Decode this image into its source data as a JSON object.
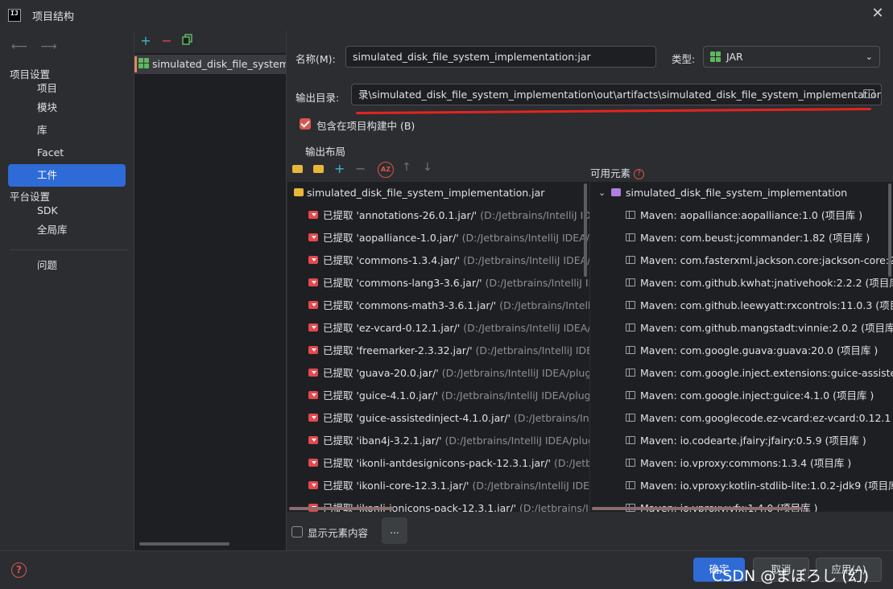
{
  "window": {
    "title": "项目结构",
    "logo_text": "IJ"
  },
  "nav": {
    "back_glyph": "⟵",
    "forward_glyph": "⟶"
  },
  "sidebar": {
    "group1": "项目设置",
    "group2": "平台设置",
    "items": [
      {
        "label": "项目"
      },
      {
        "label": "模块"
      },
      {
        "label": "库"
      },
      {
        "label": "Facet"
      },
      {
        "label": "工件"
      },
      {
        "label": "SDK"
      },
      {
        "label": "全局库"
      },
      {
        "label": "问题"
      }
    ]
  },
  "artifacts_panel": {
    "add_glyph": "+",
    "remove_glyph": "−",
    "items": [
      {
        "label": "simulated_disk_file_system_"
      }
    ]
  },
  "form": {
    "name_label": "名称(M):",
    "name_value": "simulated_disk_file_system_implementation:jar",
    "type_label": "类型:",
    "type_value": "JAR",
    "output_dir_label": "输出目录:",
    "output_dir_value": "录\\simulated_disk_file_system_implementation\\out\\artifacts\\simulated_disk_file_system_implementation_jar",
    "include_in_build_label": "包含在项目构建中 (B)",
    "include_in_build": true
  },
  "layout_section": {
    "title": "输出布局",
    "available_title": "可用元素",
    "root_jar": "simulated_disk_file_system_implementation.jar",
    "extracted_items": [
      {
        "name": "已提取 'annotations-26.0.1.jar/'",
        "path": "(D:/Jetbrains/IntelliJ IDEA/"
      },
      {
        "name": "已提取 'aopalliance-1.0.jar/'",
        "path": "(D:/Jetbrains/IntelliJ IDEA/plug"
      },
      {
        "name": "已提取 'commons-1.3.4.jar/'",
        "path": "(D:/Jetbrains/IntelliJ IDEA/plu"
      },
      {
        "name": "已提取 'commons-lang3-3.6.jar/'",
        "path": "(D:/Jetbrains/IntelliJ IDEA"
      },
      {
        "name": "已提取 'commons-math3-3.6.1.jar/'",
        "path": "(D:/Jetbrains/IntelliJ ID"
      },
      {
        "name": "已提取 'ez-vcard-0.12.1.jar/'",
        "path": "(D:/Jetbrains/IntelliJ IDEA/plug"
      },
      {
        "name": "已提取 'freemarker-2.3.32.jar/'",
        "path": "(D:/Jetbrains/IntelliJ IDEA/p"
      },
      {
        "name": "已提取 'guava-20.0.jar/'",
        "path": "(D:/Jetbrains/IntelliJ IDEA/plugins/"
      },
      {
        "name": "已提取 'guice-4.1.0.jar/'",
        "path": "(D:/Jetbrains/IntelliJ IDEA/plugins/"
      },
      {
        "name": "已提取 'guice-assistedinject-4.1.0.jar/'",
        "path": "(D:/Jetbrains/IntelliJ"
      },
      {
        "name": "已提取 'iban4j-3.2.1.jar/'",
        "path": "(D:/Jetbrains/IntelliJ IDEA/plugins"
      },
      {
        "name": "已提取 'ikonli-antdesignicons-pack-12.3.1.jar/'",
        "path": "(D:/Jetbrain"
      },
      {
        "name": "已提取 'ikonli-core-12.3.1.jar/'",
        "path": "(D:/Jetbrains/IntelliJ IDEA/pl"
      },
      {
        "name": "已提取 'ikonli-ionicons-pack-12.3.1.jar/'",
        "path": "(D:/Jetbrains/Intell"
      }
    ],
    "module_root": "simulated_disk_file_system_implementation",
    "available_items": [
      {
        "name": "Maven: aopalliance:aopalliance:1.0",
        "tag": "(项目库 )"
      },
      {
        "name": "Maven: com.beust:jcommander:1.82",
        "tag": "(项目库 )"
      },
      {
        "name": "Maven: com.fasterxml.jackson.core:jackson-core:2.15",
        "tag": ""
      },
      {
        "name": "Maven: com.github.kwhat:jnativehook:2.2.2",
        "tag": "(项目库 )"
      },
      {
        "name": "Maven: com.github.leewyatt:rxcontrols:11.0.3",
        "tag": "(项目库"
      },
      {
        "name": "Maven: com.github.mangstadt:vinnie:2.0.2",
        "tag": "(项目库 )"
      },
      {
        "name": "Maven: com.google.guava:guava:20.0",
        "tag": "(项目库 )"
      },
      {
        "name": "Maven: com.google.inject.extensions:guice-assistedin",
        "tag": ""
      },
      {
        "name": "Maven: com.google.inject:guice:4.1.0",
        "tag": "(项目库 )"
      },
      {
        "name": "Maven: com.googlecode.ez-vcard:ez-vcard:0.12.1",
        "tag": "(项"
      },
      {
        "name": "Maven: io.codearte.jfairy:jfairy:0.5.9",
        "tag": "(项目库 )"
      },
      {
        "name": "Maven: io.vproxy:commons:1.3.4",
        "tag": "(项目库 )"
      },
      {
        "name": "Maven: io.vproxy:kotlin-stdlib-lite:1.0.2-jdk9",
        "tag": "(项目库 )"
      },
      {
        "name": "Maven: io.vproxy:vfx:1.4.0",
        "tag": "(项目库 )"
      }
    ],
    "show_contents_label": "显示元素内容",
    "more_button": "..."
  },
  "footer": {
    "ok": "确定",
    "cancel": "取消",
    "apply": "应用(A)",
    "watermark": "CSDN @まぼろし (幻)"
  },
  "colors": {
    "accent": "#2e6bd6",
    "checkbox": "#d9564f",
    "annotation_line": "#e3241f",
    "extracted_icon": "#e5484d",
    "jar_icon": "#e8b73a",
    "module_icon": "#b07fe0"
  }
}
